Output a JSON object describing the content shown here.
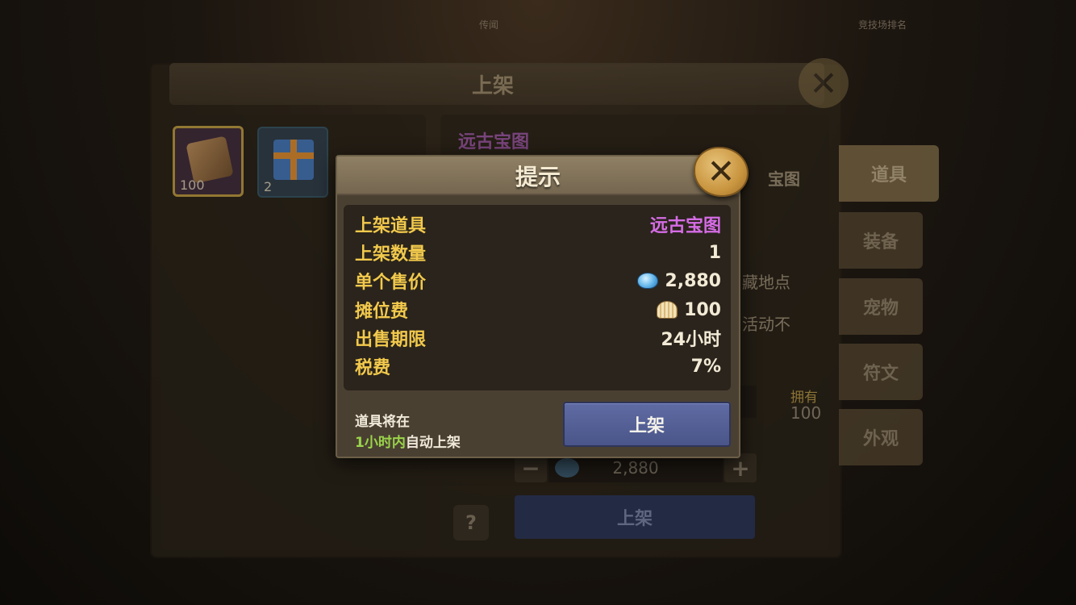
{
  "background": {
    "top_left_text": "传闻",
    "top_right_text": "竞技场排名",
    "panel_title": "上架",
    "inventory": [
      {
        "count": "100",
        "icon": "treasure-map-scroll-icon"
      },
      {
        "count": "2",
        "icon": "gift-box-icon"
      }
    ],
    "item_name": "远古宝图",
    "item_type": "宝图",
    "desc_line1": "藏地点",
    "desc_line2": "活动不",
    "owned_label": "拥有",
    "owned_value": "100",
    "price_value": "2,880",
    "minus": "−",
    "plus": "+",
    "help": "?",
    "list_button": "上架",
    "tabs": [
      "道具",
      "装备",
      "宠物",
      "符文",
      "外观"
    ]
  },
  "dialog": {
    "title": "提示",
    "close_icon": "close-x-icon",
    "rows": [
      {
        "label": "上架道具",
        "value": "远古宝图",
        "color": "#d66ce6"
      },
      {
        "label": "上架数量",
        "value": "1"
      },
      {
        "label": "单个售价",
        "value": "2,880",
        "icon": "gem-icon"
      },
      {
        "label": "摊位费",
        "value": "100",
        "icon": "shell-coin-icon"
      },
      {
        "label": "出售期限",
        "value": "24小时"
      },
      {
        "label": "税费",
        "value": "7%"
      }
    ],
    "note_line1": "道具将在",
    "note_highlight": "1小时内",
    "note_rest": "自动上架",
    "confirm_button": "上架"
  },
  "colors": {
    "label_yellow": "#f2c94c",
    "purple_item": "#d66ce6",
    "green_highlight": "#9ad44a",
    "button_blue": "#4a5589"
  }
}
